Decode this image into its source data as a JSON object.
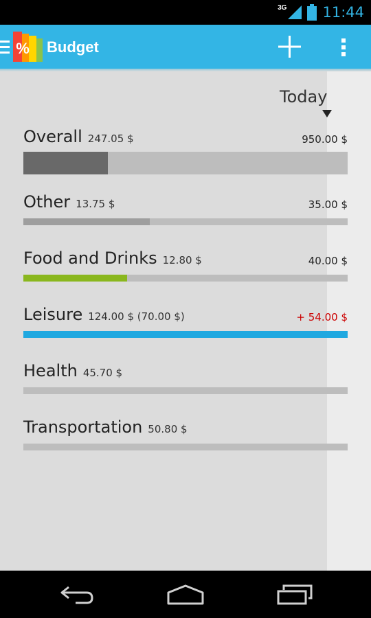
{
  "status_bar": {
    "network": "3G",
    "time": "11:44",
    "icons": [
      "signal-icon",
      "battery-icon"
    ]
  },
  "action_bar": {
    "title": "Budget",
    "actions": [
      "add-icon",
      "overflow-menu-icon"
    ],
    "color": "#33b5e5"
  },
  "timeline": {
    "today_label": "Today"
  },
  "categories": [
    {
      "name": "Overall",
      "spent": "247.05 $",
      "budget": "950.00 $",
      "fill_fraction": 0.26,
      "color": "#696969"
    },
    {
      "name": "Other",
      "spent": "13.75 $",
      "budget": "35.00 $",
      "fill_fraction": 0.39,
      "color": "#9e9e9e"
    },
    {
      "name": "Food and Drinks",
      "spent": "12.80 $",
      "budget": "40.00 $",
      "fill_fraction": 0.32,
      "color": "#8ab71e"
    },
    {
      "name": "Leisure",
      "spent": "124.00 $ (70.00 $)",
      "budget": "+ 54.00 $",
      "fill_fraction": 1.0,
      "color": "#1fa8e0",
      "over_budget": true,
      "over_color": "#cc0000"
    },
    {
      "name": "Health",
      "spent": "45.70 $",
      "budget": "",
      "fill_fraction": 0,
      "color": "#bdbdbd"
    },
    {
      "name": "Transportation",
      "spent": "50.80 $",
      "budget": "",
      "fill_fraction": 0,
      "color": "#bdbdbd"
    }
  ],
  "nav_bar": {
    "buttons": [
      "back-icon",
      "home-icon",
      "recent-apps-icon"
    ]
  }
}
